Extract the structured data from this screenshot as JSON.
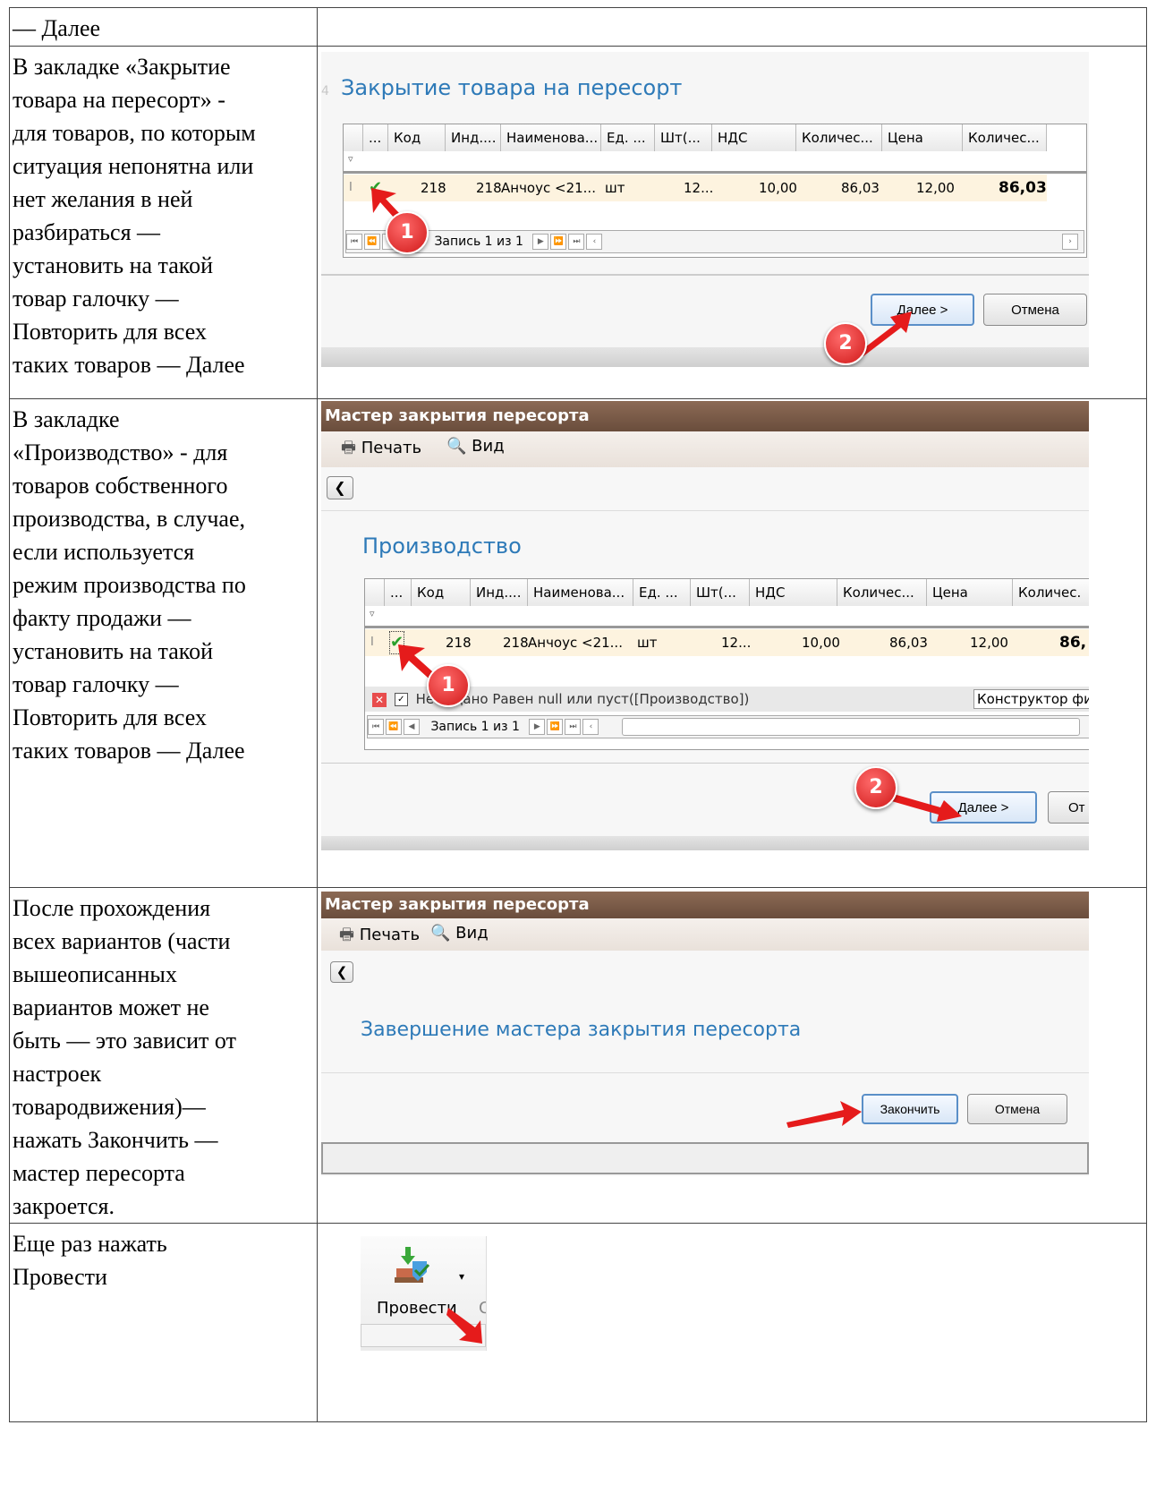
{
  "rows": [
    {
      "text": "— Далее"
    },
    {
      "text": "В закладке «Закрытие\nтовара на пересорт» -\nдля товаров, по которым\nситуация непонятна или\nнет желания в ней\nразбираться —\nустановить на такой\nтовар галочку —\nПовторить для всех\nтаких товаров — Далее"
    },
    {
      "text": "В закладке\n«Производство» - для\nтоваров собственного\nпроизводства, в случае,\nесли используется\nрежим производства по\nфакту продажи —\nустановить на такой\nтовар галочку —\nПовторить для всех\nтаких товаров — Далее"
    },
    {
      "text": "После прохождения\nвсех вариантов (части\nвышеописанных\nвариантов может не\nбыть — это зависит от\nнастроек\nтовародвижения)—\nнажать Закончить —\nмастер пересорта\nзакроется."
    },
    {
      "text": "Еще раз нажать\nПровести"
    }
  ],
  "shot1": {
    "title": "Закрытие товара на пересорт",
    "columns": [
      "...",
      "Код",
      "Инд....",
      "Наименова...",
      "Ед. ...",
      "Шт(...",
      "НДС",
      "Количес...",
      "Цена",
      "Количес..."
    ],
    "row": {
      "kod": "218",
      "ind": "218",
      "name": "Анчоус <21...",
      "ed": "шт",
      "sht": "12...",
      "nds": "10,00",
      "qty": "86,03",
      "price": "12,00",
      "qty2": "86,03"
    },
    "nav": "Запись 1 из 1",
    "next_button": "Далее >",
    "cancel_button": "Отмена",
    "badge1": "1",
    "badge2": "2"
  },
  "shot2": {
    "window_title": "Мастер закрытия пересорта",
    "print_label": "Печать",
    "view_label": "Вид",
    "title": "Производство",
    "columns": [
      "...",
      "Код",
      "Инд....",
      "Наименова...",
      "Ед. ...",
      "Шт(...",
      "НДС",
      "Количес...",
      "Цена",
      "Количес."
    ],
    "row": {
      "kod": "218",
      "ind": "218",
      "name": "Анчоус <21...",
      "ed": "шт",
      "sht": "12...",
      "nds": "10,00",
      "qty": "86,03",
      "price": "12,00",
      "qty2": "86,"
    },
    "filter_text": "Не задано Равен null или пуст([Производство])",
    "filter_builder": "Конструктор фи",
    "nav": "Запись 1 из 1",
    "next_button": "Далее >",
    "cancel_button": "От",
    "badge1": "1",
    "badge2": "2"
  },
  "shot3": {
    "window_title": "Мастер закрытия пересорта",
    "print_label": "Печать",
    "view_label": "Вид",
    "title": "Завершение мастера закрытия пересорта",
    "finish_button": "Закончить",
    "cancel_button": "Отмена"
  },
  "shot4": {
    "post_label": "Провести"
  },
  "colors": {
    "accent_title": "#2e7ab8",
    "badge": "#d01818",
    "window_bar": "#7a5a47"
  }
}
